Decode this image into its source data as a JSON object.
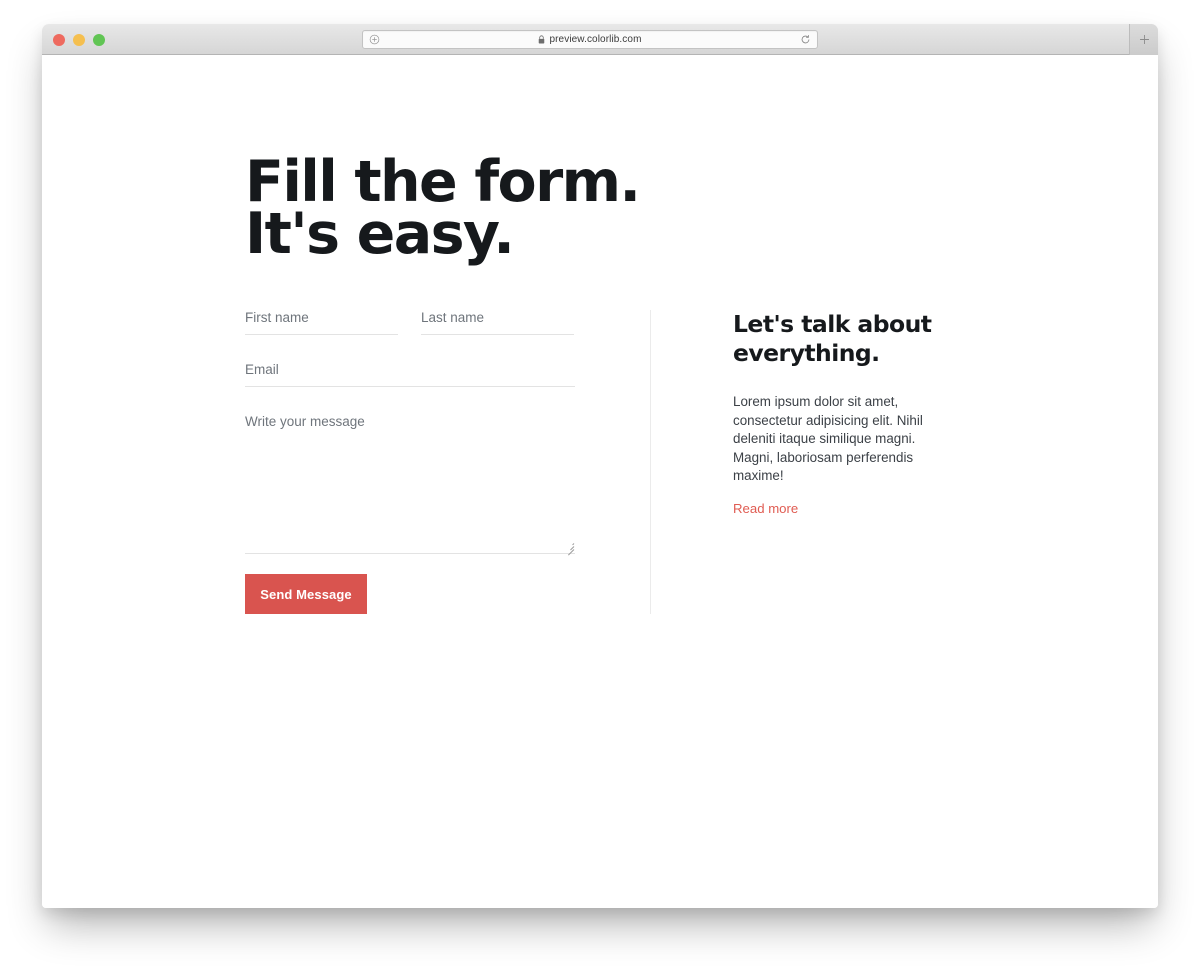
{
  "browser": {
    "traffic_lights": [
      {
        "name": "close",
        "color": "#ee6a5f"
      },
      {
        "name": "minimize",
        "color": "#f5bf4f"
      },
      {
        "name": "zoom",
        "color": "#61c554"
      }
    ],
    "url": "preview.colorlib.com",
    "left_icon": "add-circle-icon",
    "lock_icon": "lock-icon",
    "reload_icon": "reload-icon",
    "new_tab_icon": "plus-icon"
  },
  "hero": {
    "line1": "Fill the form.",
    "line2": "It's easy."
  },
  "form": {
    "first_name": {
      "placeholder": "First name",
      "value": ""
    },
    "last_name": {
      "placeholder": "Last name",
      "value": ""
    },
    "email": {
      "placeholder": "Email",
      "value": ""
    },
    "message": {
      "placeholder": "Write your message",
      "value": ""
    },
    "submit_label": "Send Message",
    "submit_color": "#d9544f"
  },
  "info": {
    "title_line1": "Let's talk about",
    "title_line2": "everything.",
    "paragraph": "Lorem ipsum dolor sit amet, consectetur adipisicing elit. Nihil deleniti itaque similique magni. Magni, laboriosam perferendis maxime!",
    "read_more_label": "Read more",
    "read_more_color": "#e05c52"
  }
}
